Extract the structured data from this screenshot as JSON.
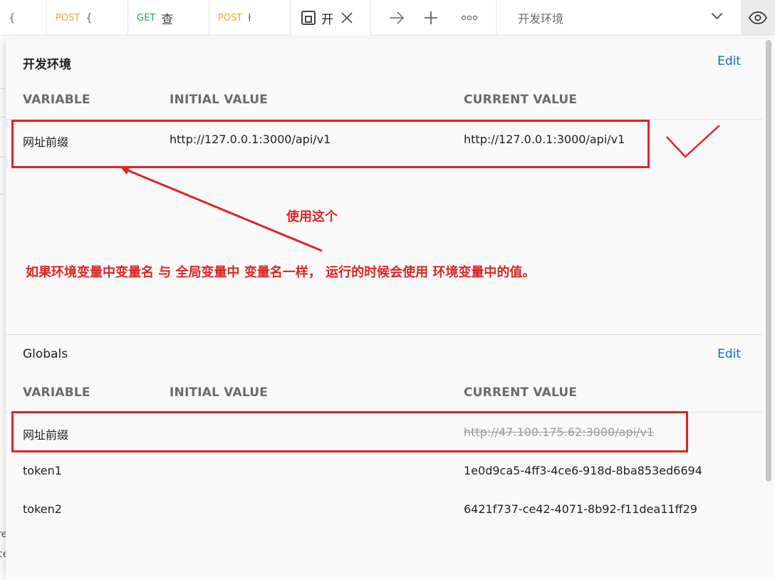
{
  "tabs": [
    {
      "method": "",
      "title": "{"
    },
    {
      "method": "POST",
      "title": "{"
    },
    {
      "method": "GET",
      "title": "查"
    },
    {
      "method": "POST",
      "title": "ł"
    }
  ],
  "active_tab": {
    "title": "开",
    "icon": "environment-icon",
    "close_icon": "close-icon"
  },
  "toolbar": {
    "forward_icon": "arrow-right-icon",
    "add_icon": "plus-icon",
    "more_icon": "more-icon"
  },
  "environment_selector": {
    "value": "开发环境",
    "icon": "chevron-down-icon"
  },
  "eye_button": {
    "icon": "eye-icon"
  },
  "background_text": [
    "re",
    "ce"
  ],
  "environment_section": {
    "title": "开发环境",
    "edit_label": "Edit",
    "columns": [
      "VARIABLE",
      "INITIAL VALUE",
      "CURRENT VALUE"
    ],
    "rows": [
      {
        "variable": "网址前缀",
        "initial": "http://127.0.0.1:3000/api/v1",
        "current": "http://127.0.0.1:3000/api/v1"
      }
    ]
  },
  "globals_section": {
    "title": "Globals",
    "edit_label": "Edit",
    "columns": [
      "VARIABLE",
      "INITIAL VALUE",
      "CURRENT VALUE"
    ],
    "rows": [
      {
        "variable": "网址前缀",
        "initial": "",
        "current": "http://47.100.175.62:3000/api/v1",
        "overridden": true
      },
      {
        "variable": "token1",
        "initial": "",
        "current": "1e0d9ca5-4ff3-4ce6-918d-8ba853ed6694"
      },
      {
        "variable": "token2",
        "initial": "",
        "current": "6421f737-ce42-4071-8b92-f11dea11ff29"
      }
    ]
  },
  "annotations": {
    "use_this": "使用这个",
    "explanation": "如果环境变量中变量名 与 全局变量中 变量名一样， 运行的时候会使用 环境变量中的值。",
    "color": "#e02424"
  }
}
